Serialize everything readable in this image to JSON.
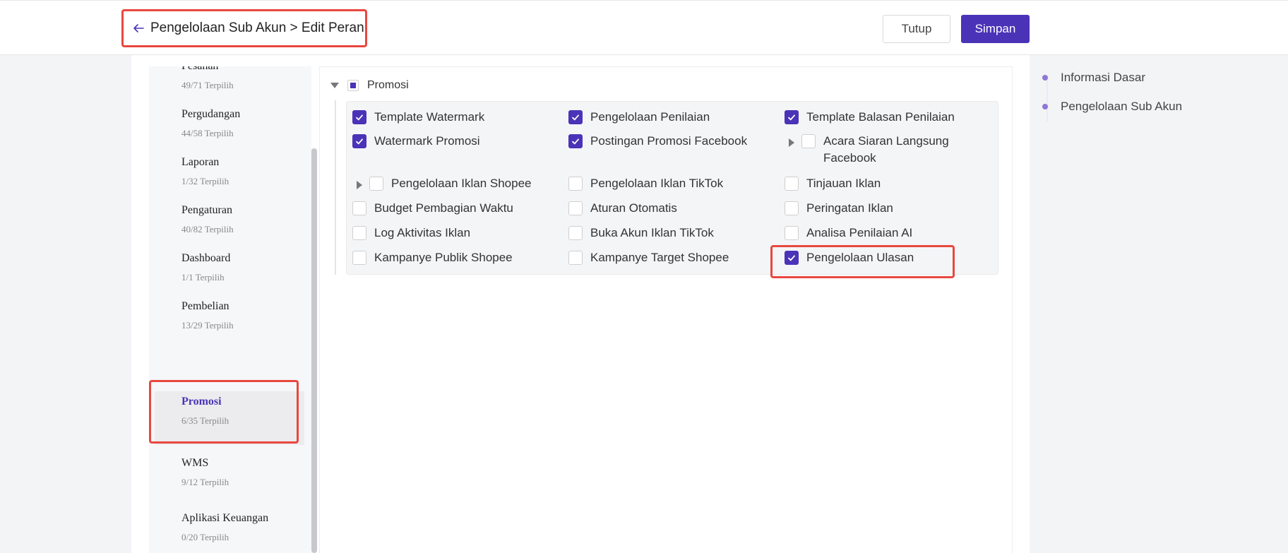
{
  "header": {
    "title": "Pengelolaan Sub Akun > Edit Peran",
    "close_label": "Tutup",
    "save_label": "Simpan"
  },
  "colors": {
    "accent": "#4b33b8",
    "highlight": "#e8483f"
  },
  "categories": [
    {
      "name": "Pesanan",
      "count": "49/71 Terpilih"
    },
    {
      "name": "Pergudangan",
      "count": "44/58 Terpilih"
    },
    {
      "name": "Laporan",
      "count": "1/32 Terpilih"
    },
    {
      "name": "Pengaturan",
      "count": "40/82 Terpilih"
    },
    {
      "name": "Dashboard",
      "count": "1/1 Terpilih"
    },
    {
      "name": "Pembelian",
      "count": "13/29 Terpilih"
    },
    {
      "name": "Promosi",
      "count": "6/35 Terpilih",
      "active": true
    },
    {
      "name": "WMS",
      "count": "9/12 Terpilih"
    },
    {
      "name": "Aplikasi Keuangan",
      "count": "0/20 Terpilih"
    }
  ],
  "section": {
    "label": "Promosi",
    "permissions": [
      {
        "label": "Template Watermark",
        "checked": true
      },
      {
        "label": "Pengelolaan Penilaian",
        "checked": true
      },
      {
        "label": "Template Balasan Penilaian",
        "checked": true
      },
      {
        "label": "Watermark Promosi",
        "checked": true
      },
      {
        "label": "Postingan Promosi Facebook",
        "checked": true
      },
      {
        "label": "Acara Siaran Langsung",
        "label2": "Facebook",
        "checked": false,
        "expandable": true
      },
      {
        "label": "Pengelolaan Iklan Shopee",
        "checked": false,
        "expandable": true
      },
      {
        "label": "Pengelolaan Iklan TikTok",
        "checked": false
      },
      {
        "label": "Tinjauan Iklan",
        "checked": false
      },
      {
        "label": "Budget Pembagian Waktu",
        "checked": false
      },
      {
        "label": "Aturan Otomatis",
        "checked": false
      },
      {
        "label": "Peringatan Iklan",
        "checked": false
      },
      {
        "label": "Log Aktivitas Iklan",
        "checked": false
      },
      {
        "label": "Buka Akun Iklan TikTok",
        "checked": false
      },
      {
        "label": "Analisa Penilaian AI",
        "checked": false
      },
      {
        "label": "Kampanye Publik Shopee",
        "checked": false
      },
      {
        "label": "Kampanye Target Shopee",
        "checked": false
      },
      {
        "label": "Pengelolaan Ulasan",
        "checked": true
      }
    ]
  },
  "toc": [
    {
      "label": "Informasi Dasar"
    },
    {
      "label": "Pengelolaan Sub Akun"
    }
  ]
}
